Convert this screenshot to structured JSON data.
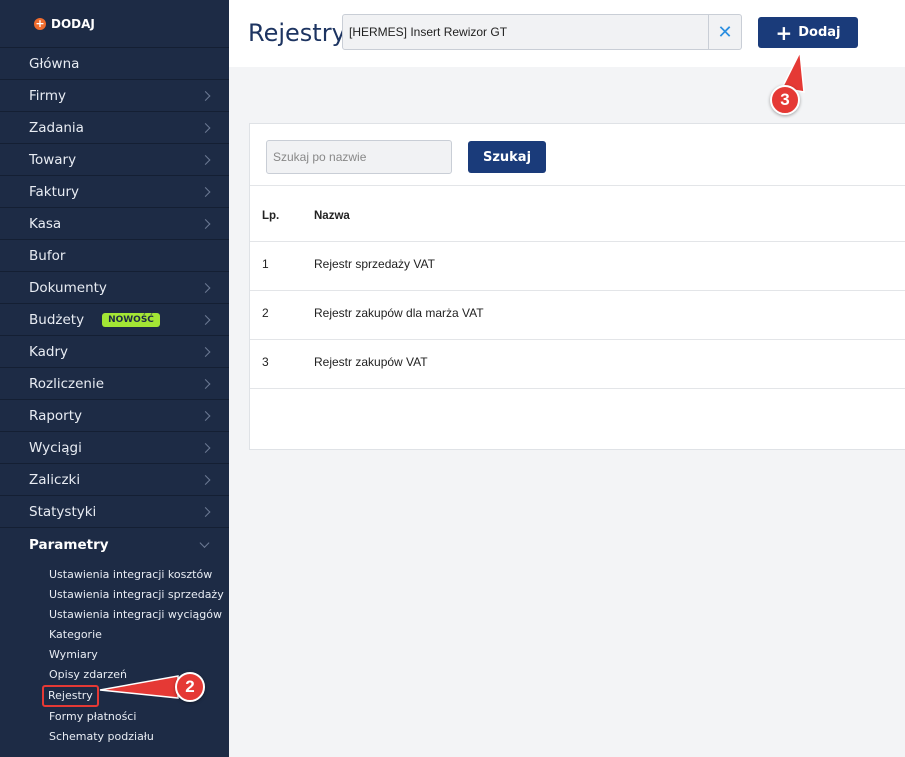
{
  "sidebar": {
    "add_label": "DODAJ",
    "items": [
      {
        "label": "Główna",
        "chevron": false
      },
      {
        "label": "Firmy",
        "chevron": true
      },
      {
        "label": "Zadania",
        "chevron": true
      },
      {
        "label": "Towary",
        "chevron": true
      },
      {
        "label": "Faktury",
        "chevron": true
      },
      {
        "label": "Kasa",
        "chevron": true
      },
      {
        "label": "Bufor",
        "chevron": false
      },
      {
        "label": "Dokumenty",
        "chevron": true
      },
      {
        "label": "Budżety",
        "chevron": true,
        "badge": "NOWOŚĆ"
      },
      {
        "label": "Kadry",
        "chevron": true
      },
      {
        "label": "Rozliczenie",
        "chevron": true
      },
      {
        "label": "Raporty",
        "chevron": true
      },
      {
        "label": "Wyciągi",
        "chevron": true
      },
      {
        "label": "Zaliczki",
        "chevron": true
      },
      {
        "label": "Statystyki",
        "chevron": true
      }
    ],
    "active_section": "Parametry",
    "sub_items": [
      "Ustawienia integracji kosztów",
      "Ustawienia integracji sprzedaży",
      "Ustawienia integracji wyciągów",
      "Kategorie",
      "Wymiary",
      "Opisy zdarzeń",
      "Rejestry",
      "Formy płatności",
      "Schematy podziału"
    ],
    "highlighted_sub_item": "Rejestry"
  },
  "header": {
    "title": "Rejestry",
    "company_select_value": "[HERMES] Insert Rewizor GT",
    "clear_icon": "close-icon",
    "add_button_label": "Dodaj"
  },
  "search": {
    "placeholder": "Szukaj po nazwie",
    "button_label": "Szukaj"
  },
  "table": {
    "columns": [
      "Lp.",
      "Nazwa"
    ],
    "rows": [
      {
        "lp": "1",
        "name": "Rejestr sprzedaży VAT"
      },
      {
        "lp": "2",
        "name": "Rejestr zakupów dla marża VAT"
      },
      {
        "lp": "3",
        "name": "Rejestr zakupów VAT"
      }
    ]
  },
  "annotations": {
    "callout_2": "2",
    "callout_3": "3",
    "color": "#e53935"
  },
  "colors": {
    "sidebar_bg": "#1d2b45",
    "primary_button": "#1a3b7a",
    "accent_orange": "#ef6c2d",
    "badge_green": "#a3e635"
  }
}
